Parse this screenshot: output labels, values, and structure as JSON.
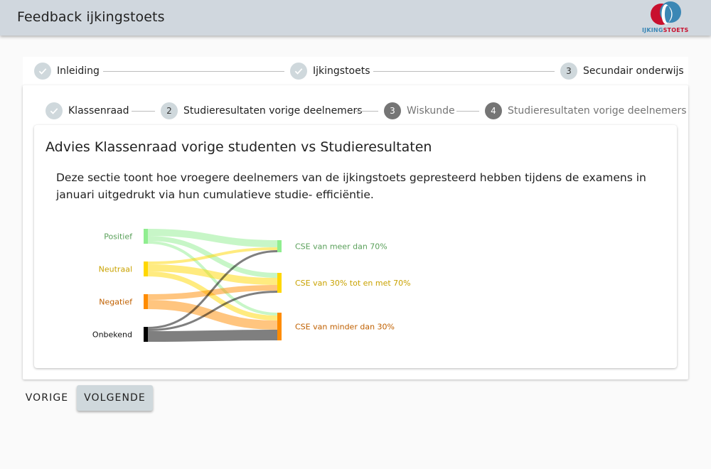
{
  "header": {
    "title": "Feedback ijkingstoets",
    "logo_text_a": "IJKING",
    "logo_text_b": "STOETS"
  },
  "outer_steps": [
    {
      "label": "Inleiding",
      "state": "done"
    },
    {
      "label": "Ijkingstoets",
      "state": "done"
    },
    {
      "number": "3",
      "label": "Secundair onderwijs",
      "state": "current"
    }
  ],
  "inner_steps": [
    {
      "label": "Klassenraad",
      "state": "done"
    },
    {
      "number": "2",
      "label": "Studieresultaten vorige deelnemers",
      "state": "current"
    },
    {
      "number": "3",
      "label": "Wiskunde",
      "state": "todo"
    },
    {
      "number": "4",
      "label": "Studieresultaten vorige deelnemers",
      "state": "todo"
    }
  ],
  "section": {
    "title": "Advies Klassenraad vorige studenten vs Studieresultaten",
    "description": "Deze sectie toont hoe vroegere deelnemers van de ijkingstoets gepresteerd hebben tijdens de examens in januari uitgedrukt via hun cumulatieve studie- efficiëntie."
  },
  "chart_data": {
    "type": "sankey",
    "sources": [
      {
        "name": "Positief",
        "color": "#90ee90",
        "label_color": "#5aa05a"
      },
      {
        "name": "Neutraal",
        "color": "#ffd700",
        "label_color": "#c9a200"
      },
      {
        "name": "Negatief",
        "color": "#ff8c00",
        "label_color": "#c06000"
      },
      {
        "name": "Onbekend",
        "color": "#000000",
        "label_color": "#111111"
      }
    ],
    "targets": [
      {
        "name": "CSE van meer dan 70%",
        "color": "#90ee90",
        "label_color": "#5aa05a"
      },
      {
        "name": "CSE van 30% tot en met 70%",
        "color": "#ffd700",
        "label_color": "#c9a200"
      },
      {
        "name": "CSE van minder dan 30%",
        "color": "#ff8c00",
        "label_color": "#c06000"
      }
    ],
    "links": [
      {
        "source": "Positief",
        "target": "CSE van meer dan 70%",
        "value": 10
      },
      {
        "source": "Positief",
        "target": "CSE van 30% tot en met 70%",
        "value": 7
      },
      {
        "source": "Positief",
        "target": "CSE van minder dan 30%",
        "value": 4
      },
      {
        "source": "Neutraal",
        "target": "CSE van meer dan 70%",
        "value": 4
      },
      {
        "source": "Neutraal",
        "target": "CSE van 30% tot en met 70%",
        "value": 10
      },
      {
        "source": "Neutraal",
        "target": "CSE van minder dan 30%",
        "value": 7
      },
      {
        "source": "Negatief",
        "target": "CSE van 30% tot en met 70%",
        "value": 8
      },
      {
        "source": "Negatief",
        "target": "CSE van minder dan 30%",
        "value": 13
      },
      {
        "source": "Onbekend",
        "target": "CSE van meer dan 70%",
        "value": 3
      },
      {
        "source": "Onbekend",
        "target": "CSE van 30% tot en met 70%",
        "value": 3
      },
      {
        "source": "Onbekend",
        "target": "CSE van minder dan 30%",
        "value": 15
      }
    ]
  },
  "nav": {
    "prev_label": "VORIGE",
    "next_label": "VOLGENDE"
  }
}
